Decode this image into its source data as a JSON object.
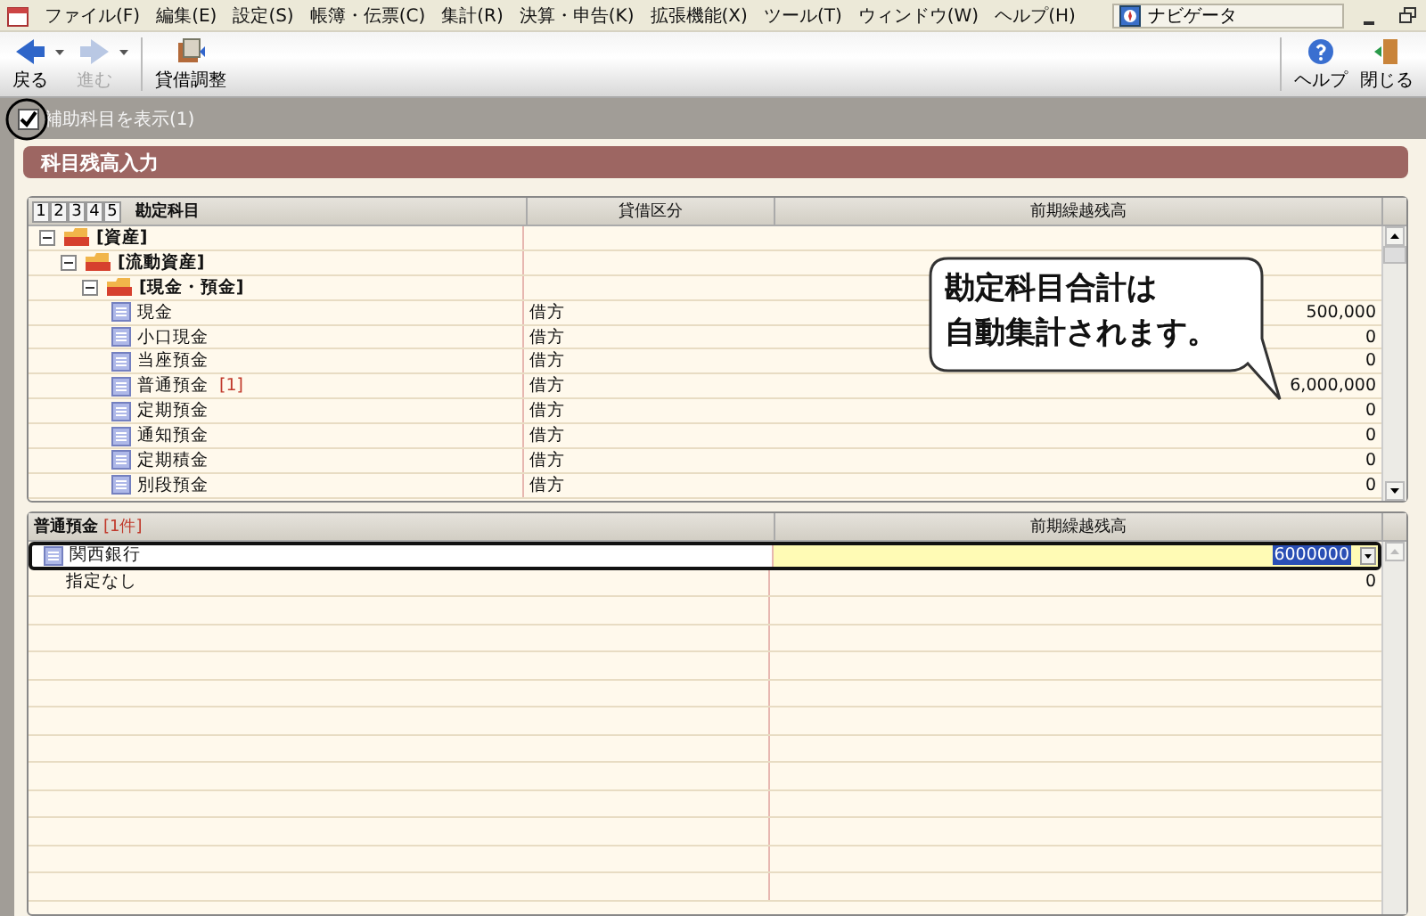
{
  "menu": [
    {
      "label": "ファイル(F)"
    },
    {
      "label": "編集(E)"
    },
    {
      "label": "設定(S)"
    },
    {
      "label": "帳簿・伝票(C)"
    },
    {
      "label": "集計(R)"
    },
    {
      "label": "決算・申告(K)"
    },
    {
      "label": "拡張機能(X)"
    },
    {
      "label": "ツール(T)"
    },
    {
      "label": "ウィンドウ(W)"
    },
    {
      "label": "ヘルプ(H)"
    }
  ],
  "navigator": {
    "label": "ナビゲータ"
  },
  "toolbar": [
    {
      "kind": "back",
      "label": "戻る",
      "disabled": false
    },
    {
      "kind": "forward",
      "label": "進む",
      "disabled": true
    },
    {
      "kind": "adjust",
      "label": "貸借調整",
      "disabled": false
    }
  ],
  "toolbar_right": [
    {
      "kind": "help",
      "label": "ヘルプ"
    },
    {
      "kind": "close",
      "label": "閉じる"
    }
  ],
  "option": {
    "label": "補助科目を表示(1)",
    "checked": true
  },
  "section_title": "科目残高入力",
  "account_grid": {
    "level_buttons": [
      "1",
      "2",
      "3",
      "4",
      "5"
    ],
    "columns": [
      "勘定科目",
      "貸借区分",
      "前期繰越残高"
    ],
    "rows": [
      {
        "kind": "folder",
        "name": "[資産]",
        "expanded": true,
        "children": [
          {
            "kind": "folder",
            "name": "[流動資産]",
            "expanded": true,
            "children": [
              {
                "kind": "folder",
                "name": "[現金・預金]",
                "expanded": true,
                "children": [
                  {
                    "kind": "account",
                    "name": "現金",
                    "side": "借方",
                    "balance": "500,000"
                  },
                  {
                    "kind": "account",
                    "name": "小口現金",
                    "side": "借方",
                    "balance": "0"
                  },
                  {
                    "kind": "account",
                    "name": "当座預金",
                    "side": "借方",
                    "balance": "0"
                  },
                  {
                    "kind": "account",
                    "name": "普通預金",
                    "count": "[1]",
                    "side": "借方",
                    "balance": "6,000,000"
                  },
                  {
                    "kind": "account",
                    "name": "定期預金",
                    "side": "借方",
                    "balance": "0"
                  },
                  {
                    "kind": "account",
                    "name": "通知預金",
                    "side": "借方",
                    "balance": "0"
                  },
                  {
                    "kind": "account",
                    "name": "定期積金",
                    "side": "借方",
                    "balance": "0"
                  },
                  {
                    "kind": "account",
                    "name": "別段預金",
                    "side": "借方",
                    "balance": "0"
                  }
                ]
              }
            ]
          }
        ]
      }
    ]
  },
  "sub_grid": {
    "title": "普通預金",
    "count": "[1件]",
    "column": "前期繰越残高",
    "rows": [
      {
        "kind": "bank",
        "name": "関西銀行",
        "value": "6000000",
        "selected": true
      },
      {
        "kind": "none",
        "name": "指定なし",
        "value": "0",
        "selected": false
      }
    ]
  },
  "callout": {
    "lines": [
      "勘定科目合計は",
      "自動集計されます。"
    ]
  }
}
